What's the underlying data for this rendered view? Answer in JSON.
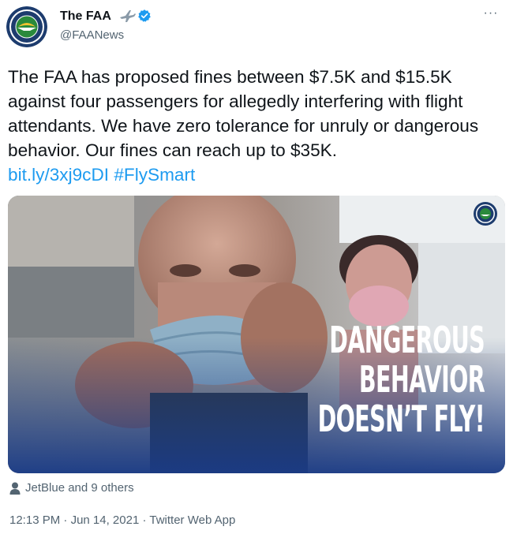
{
  "author": {
    "display_name": "The FAA",
    "handle": "@FAANews",
    "avatar_icon": "faa-seal-icon",
    "name_icon": "airplane-icon",
    "verified_icon": "verified-badge-icon"
  },
  "menu": {
    "more_icon": "more-options-icon",
    "more_glyph": "···"
  },
  "text": {
    "body": "The FAA has proposed fines between $7.5K and $15.5K against four passengers for allegedly interfering with flight attendants. We have zero tolerance for unruly or dangerous behavior. Our fines can reach up to $35K.",
    "link": "bit.ly/3xj9cDI",
    "hashtag": "#FlySmart"
  },
  "media": {
    "overlay_lines": [
      "DANGEROUS",
      "BEHAVIOR",
      "DOESN’T FLY!"
    ],
    "logo_icon": "faa-seal-icon"
  },
  "tags": {
    "icon": "person-icon",
    "label": "JetBlue and 9 others"
  },
  "meta": {
    "time": "12:13 PM",
    "separator": " · ",
    "date": "Jun 14, 2021",
    "source": "Twitter Web App"
  },
  "colors": {
    "link": "#1d9bf0",
    "muted": "#536471",
    "text": "#0f1419"
  }
}
